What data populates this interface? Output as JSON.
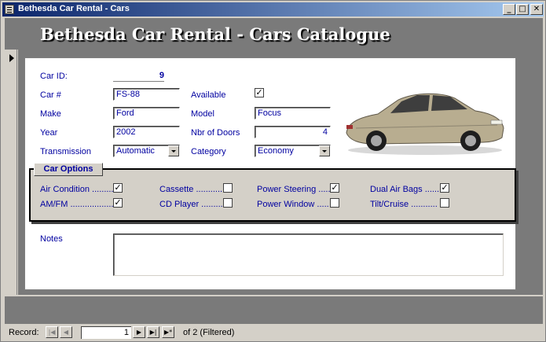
{
  "window": {
    "title": "Bethesda Car Rental - Cars",
    "minimize_glyph": "_",
    "maximize_glyph": "□",
    "close_glyph": "✕"
  },
  "header": {
    "title": "Bethesda Car Rental - Cars Catalogue"
  },
  "form": {
    "car_id_label": "Car ID:",
    "car_id_value": "9",
    "car_no_label": "Car #",
    "car_no_value": "FS-88",
    "available_label": "Available",
    "available_checked": true,
    "make_label": "Make",
    "make_value": "Ford",
    "model_label": "Model",
    "model_value": "Focus",
    "year_label": "Year",
    "year_value": "2002",
    "doors_label": "Nbr of Doors",
    "doors_value": "4",
    "transmission_label": "Transmission",
    "transmission_value": "Automatic",
    "category_label": "Category",
    "category_value": "Economy",
    "notes_label": "Notes",
    "notes_value": ""
  },
  "options": {
    "tab_label": "Car Options",
    "items": [
      {
        "label": "Air Condition .........",
        "checked": true
      },
      {
        "label": "AM/FM ..................",
        "checked": true
      },
      {
        "label": "Cassette ............",
        "checked": false
      },
      {
        "label": "CD Player ..........",
        "checked": false
      },
      {
        "label": "Power Steering .....",
        "checked": true
      },
      {
        "label": "Power Window .....",
        "checked": false
      },
      {
        "label": "Dual Air Bags ......",
        "checked": true
      },
      {
        "label": "Tilt/Cruise ...........",
        "checked": false
      }
    ]
  },
  "navigation": {
    "record_label": "Record:",
    "first_glyph": "|◀",
    "prev_glyph": "◀",
    "current_record": "1",
    "next_glyph": "▶",
    "last_glyph": "▶|",
    "new_glyph": "▶*",
    "of_label": "of  2 (Filtered)"
  },
  "colors": {
    "label": "#0000a0",
    "band": "#7a7a7a",
    "title_start": "#0a246a",
    "title_end": "#a6caf0"
  }
}
